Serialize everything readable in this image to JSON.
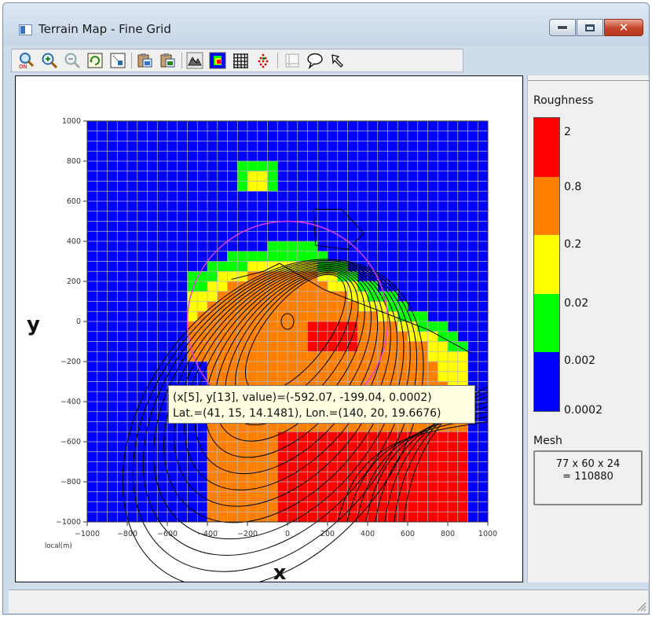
{
  "window": {
    "title": "Terrain Map - Fine Grid"
  },
  "toolbar": {
    "tools": [
      {
        "name": "zoom-on-icon"
      },
      {
        "name": "zoom-in-icon"
      },
      {
        "name": "zoom-out-icon"
      },
      {
        "name": "refresh-icon"
      },
      {
        "name": "fit-view-icon"
      },
      {
        "name": "copy-image-icon"
      },
      {
        "name": "export-image-icon"
      },
      {
        "name": "terrain-view-icon"
      },
      {
        "name": "color-map-icon"
      },
      {
        "name": "grid-icon"
      },
      {
        "name": "points-icon"
      },
      {
        "name": "frame-icon"
      },
      {
        "name": "balloon-icon"
      },
      {
        "name": "pointer-icon"
      }
    ]
  },
  "plot": {
    "xlabel": "x",
    "ylabel": "y",
    "unit_label": "local(m)",
    "xticks": [
      "−1000",
      "−800",
      "−600",
      "−400",
      "−200",
      "0",
      "200",
      "400",
      "600",
      "800",
      "1000"
    ],
    "yticks": [
      "1000",
      "800",
      "600",
      "400",
      "200",
      "0",
      "−200",
      "−400",
      "−600",
      "−800",
      "−1000"
    ],
    "colors": {
      "blue": "#0000ff",
      "green": "#00ff00",
      "yellow": "#ffff00",
      "orange": "#ff8000",
      "red": "#ff0000",
      "circle": "#e040e0"
    }
  },
  "tooltip": {
    "line1": "(x[5], y[13], value)=(-592.07, -199.04, 0.0002)",
    "line2": "Lat.=(41, 15, 14.1481), Lon.=(140, 20, 19.6676)"
  },
  "legend": {
    "title": "Roughness",
    "labels": [
      "2",
      "0.8",
      "0.2",
      "0.02",
      "0.002",
      "0.0002"
    ],
    "colors": [
      "#ff0000",
      "#ff8000",
      "#ffff00",
      "#00ff00",
      "#0000ff"
    ]
  },
  "mesh": {
    "title": "Mesh",
    "line1": "77 x 60 x 24",
    "line2": "= 110880"
  }
}
